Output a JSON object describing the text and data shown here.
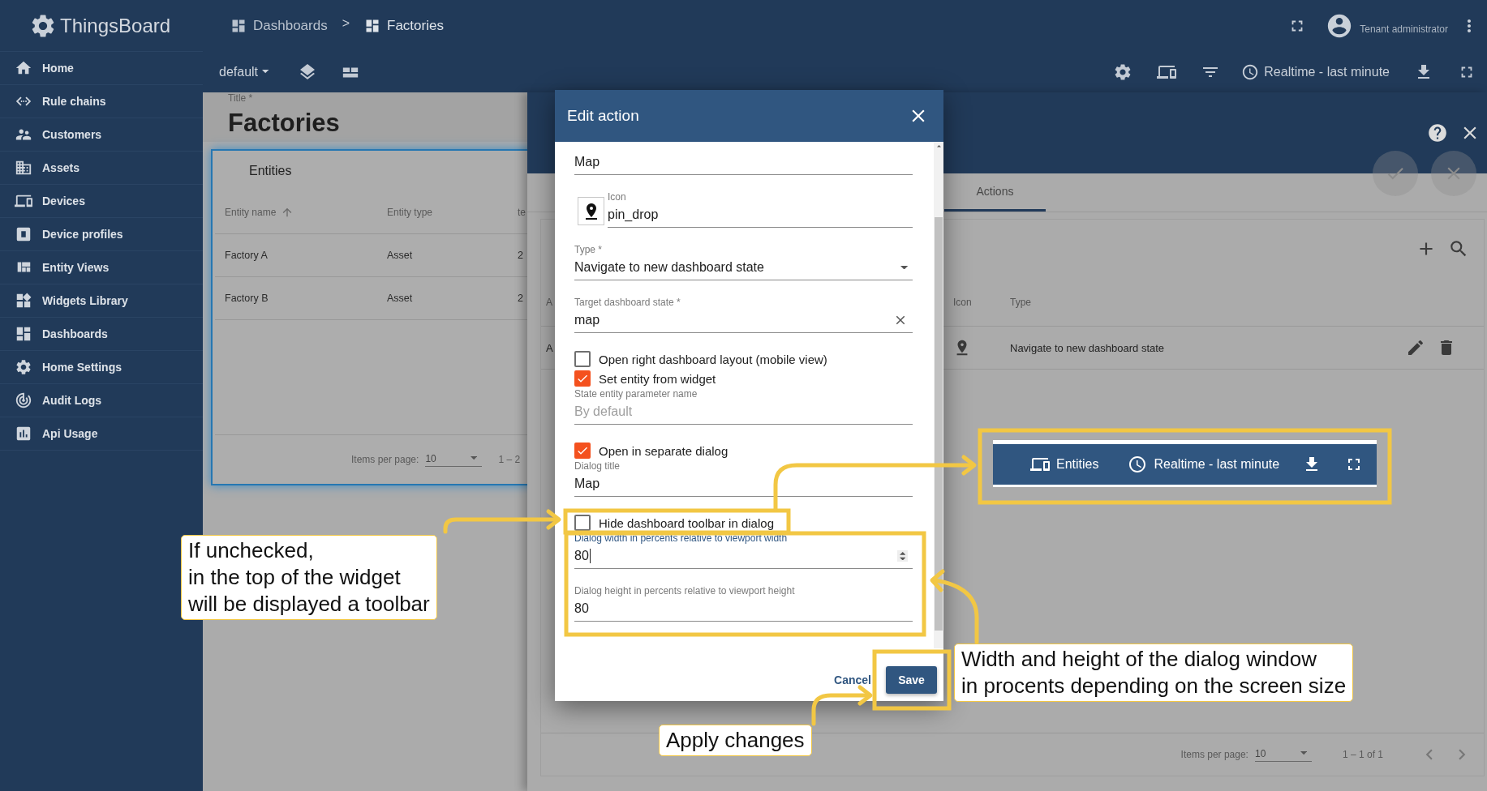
{
  "sidebar": {
    "logo": "ThingsBoard",
    "items": [
      {
        "label": "Home",
        "selected": false
      },
      {
        "label": "Rule chains",
        "selected": false
      },
      {
        "label": "Customers",
        "selected": false
      },
      {
        "label": "Assets",
        "selected": false
      },
      {
        "label": "Devices",
        "selected": false
      },
      {
        "label": "Device profiles",
        "selected": false
      },
      {
        "label": "Entity Views",
        "selected": false
      },
      {
        "label": "Widgets Library",
        "selected": false
      },
      {
        "label": "Dashboards",
        "selected": false
      },
      {
        "label": "Home Settings",
        "selected": false
      },
      {
        "label": "Audit Logs",
        "selected": false
      },
      {
        "label": "Api Usage",
        "selected": false
      }
    ]
  },
  "breadcrumbs": {
    "items": [
      "Dashboards",
      "Factories"
    ],
    "separator": ">"
  },
  "user": {
    "role": "Tenant administrator"
  },
  "toolbar": {
    "state": "default",
    "timewindow": "Realtime - last minute"
  },
  "dashboard": {
    "title_label": "Title *",
    "title": "Factories",
    "widget": {
      "title": "Entities",
      "columns": [
        {
          "label": "Entity name",
          "sorted": true
        },
        {
          "label": "Entity type",
          "sorted": false
        },
        {
          "label": "te",
          "sorted": false
        }
      ],
      "rows": [
        [
          "Factory A",
          "Asset",
          "2"
        ],
        [
          "Factory B",
          "Asset",
          "2"
        ]
      ],
      "paginator": {
        "label": "Items per page:",
        "page_size": "10",
        "range": "1 – 2"
      }
    }
  },
  "widget_editor": {
    "tabs": [
      {
        "label": "Actions",
        "selected": true
      }
    ],
    "table": {
      "columns": [
        "A",
        "Icon",
        "Type"
      ],
      "rows": [
        {
          "column_1": "A",
          "type": "Navigate to new dashboard state"
        }
      ]
    },
    "paginator": {
      "label": "Items per page:",
      "page_size": "10",
      "range": "1 – 1 of 1"
    }
  },
  "dialog": {
    "title": "Edit action",
    "fields": [
      {
        "kind": "text",
        "value": "Map"
      },
      {
        "kind": "icon",
        "label": "Icon",
        "value": "pin_drop"
      },
      {
        "kind": "select",
        "label": "Type *",
        "value": "Navigate to new dashboard state"
      },
      {
        "kind": "clearable",
        "label": "Target dashboard state *",
        "value": "map"
      },
      {
        "kind": "checkbox",
        "label": "Open right dashboard layout (mobile view)",
        "checked": false
      },
      {
        "kind": "checkbox",
        "label": "Set entity from widget",
        "checked": true
      },
      {
        "kind": "text",
        "label": "State entity parameter name",
        "placeholder": "By default"
      },
      {
        "kind": "checkbox",
        "label": "Open in separate dialog",
        "checked": true
      },
      {
        "kind": "text",
        "label": "Dialog title",
        "value": "Map"
      },
      {
        "kind": "checkbox",
        "label": "Hide dashboard toolbar in dialog",
        "checked": false
      },
      {
        "kind": "number",
        "label": "Dialog width in percents relative to viewport width",
        "value": "80",
        "focused": true
      },
      {
        "kind": "text",
        "label": "Dialog height in percents relative to viewport height",
        "value": "80"
      }
    ],
    "buttons": {
      "cancel": "Cancel",
      "save": "Save"
    }
  },
  "annotations": {
    "toolbar_preview": {
      "title": "Entities",
      "timewindow": "Realtime - last minute"
    },
    "callouts": [
      "If unchecked,\nin the top of the widget\nwill be displayed a toolbar",
      "Width and height of the dialog window\nin procents depending on the screen size",
      "Apply changes"
    ]
  }
}
